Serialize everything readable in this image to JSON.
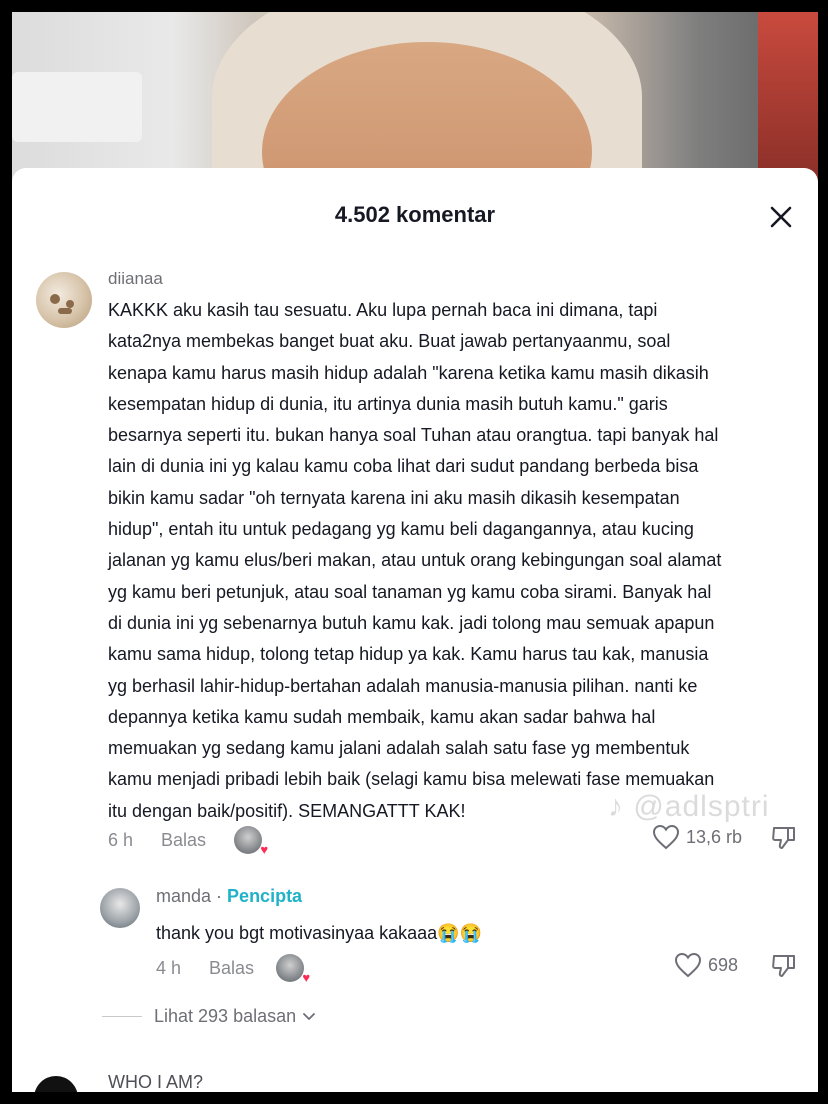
{
  "sheet": {
    "title": "4.502 komentar"
  },
  "comments": [
    {
      "username": "diianaa",
      "lines": [
        "KAKKK aku kasih tau sesuatu. Aku lupa pernah baca ini dimana, tapi",
        "kata2nya membekas banget buat aku. Buat jawab pertanyaanmu, soal",
        "kenapa kamu harus masih hidup adalah \"karena ketika kamu masih dikasih",
        "kesempatan hidup di dunia, itu artinya dunia masih butuh kamu.\" garis",
        "besarnya seperti itu. bukan hanya soal Tuhan atau orangtua. tapi banyak hal",
        "lain di dunia ini yg kalau kamu coba lihat dari sudut pandang berbeda bisa",
        "bikin kamu sadar \"oh ternyata karena ini aku masih dikasih kesempatan",
        "hidup\", entah itu untuk pedagang yg kamu beli dagangannya, atau kucing",
        "jalanan yg kamu elus/beri makan, atau untuk orang kebingungan soal alamat",
        "yg kamu beri petunjuk, atau soal tanaman yg kamu coba sirami. Banyak hal",
        "di dunia ini yg sebenarnya butuh kamu kak. jadi tolong mau semuak apapun",
        "kamu sama hidup, tolong tetap hidup ya kak. Kamu harus tau kak, manusia",
        "yg berhasil lahir-hidup-bertahan adalah manusia-manusia pilihan. nanti ke",
        "depannya ketika kamu sudah membaik, kamu akan sadar bahwa hal",
        "memuakan yg sedang kamu jalani adalah salah satu fase yg membentuk",
        "kamu menjadi pribadi lebih baik (selagi kamu bisa melewati fase memuakan",
        "itu dengan baik/positif). SEMANGATTT KAK!"
      ],
      "time": "6 h",
      "reply_label": "Balas",
      "likes": "13,6 rb"
    }
  ],
  "reply": {
    "username": "manda",
    "separator": " · ",
    "badge": "Pencipta",
    "text": "thank you bgt motivasinyaa kakaaa😭😭",
    "time": "4 h",
    "reply_label": "Balas",
    "likes": "698"
  },
  "view_replies": "Lihat 293 balasan",
  "next_comment": {
    "username": "WHO I AM?"
  },
  "watermark": "♪ @adlsptri",
  "icons": {
    "close": "close-icon",
    "heart": "heart-outline-icon",
    "dislike": "thumb-down-icon",
    "chevron": "chevron-down-icon"
  },
  "colors": {
    "text": "#161823",
    "muted": "#8a8b91",
    "creator": "#20b2c8",
    "heart": "#fe2c55"
  }
}
